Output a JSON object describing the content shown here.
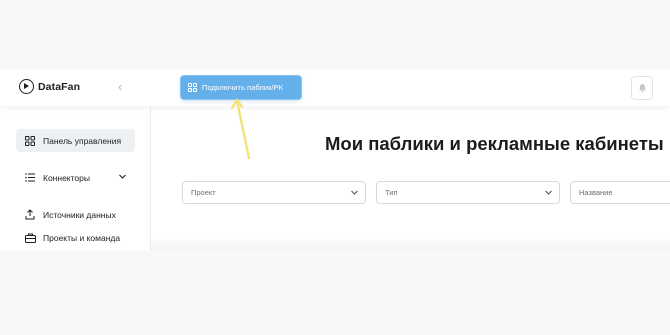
{
  "header": {
    "logo_text": "DataFan",
    "collapse_icon": "chevron-left-icon",
    "connect_button_label": "Подключить паблик/РК",
    "notification_icon": "bell-icon"
  },
  "sidebar": {
    "items": [
      {
        "label": "Панель управления",
        "icon": "grid-icon",
        "active": true
      },
      {
        "label": "Коннекторы",
        "icon": "list-icon",
        "expandable": true
      },
      {
        "label": "Источники данных",
        "icon": "upload-icon"
      },
      {
        "label": "Проекты и команда",
        "icon": "briefcase-icon"
      }
    ]
  },
  "main": {
    "title": "Мои паблики и рекламные кабинеты",
    "filters": [
      {
        "placeholder": "Проект"
      },
      {
        "placeholder": "Тип"
      },
      {
        "placeholder": "Название"
      }
    ]
  },
  "colors": {
    "accent": "#64b0ea",
    "annotation_arrow": "#f3e27a"
  }
}
